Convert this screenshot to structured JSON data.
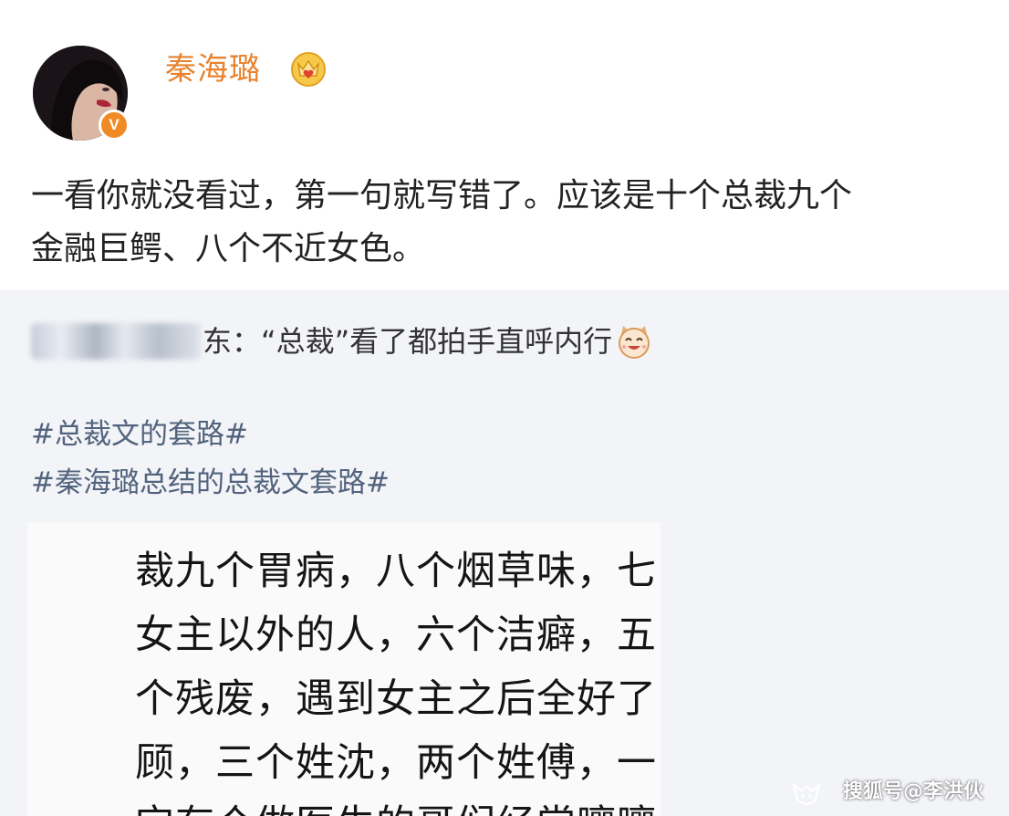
{
  "post": {
    "author": {
      "name": "秦海璐",
      "verified_badge": "V",
      "avatar_icon": "avatar-photo",
      "vip_icon": "crown-heart-icon"
    },
    "text_lines": [
      "一看你就没看过，第一句就写错了。应该是十个总裁九个",
      "金融巨鳄、八个不近女色。"
    ]
  },
  "repost": {
    "quote_text": "东：“总裁”看了都拍手直呼内行",
    "emoji_icon": "cat-laughing-icon",
    "hashtags": [
      "#总裁文的套路#",
      "#秦海璐总结的总裁文套路#"
    ]
  },
  "screenshot_image": {
    "lines": [
      "裁九个胃病，八个烟草味，七",
      "女主以外的人，六个洁癖，五",
      "个残废，遇到女主之后全好了",
      "顾，三个姓沈，两个姓傅，一",
      "宝有个做医生的哥们经常嚷嚷"
    ]
  },
  "watermark": {
    "text": "搜狐号@李洪伙",
    "icon": "sohu-fox-icon"
  },
  "colors": {
    "username": "#e8822e",
    "hashtag": "#52637d",
    "verified_badge": "#f08a24",
    "background": "#f3f4f8"
  }
}
